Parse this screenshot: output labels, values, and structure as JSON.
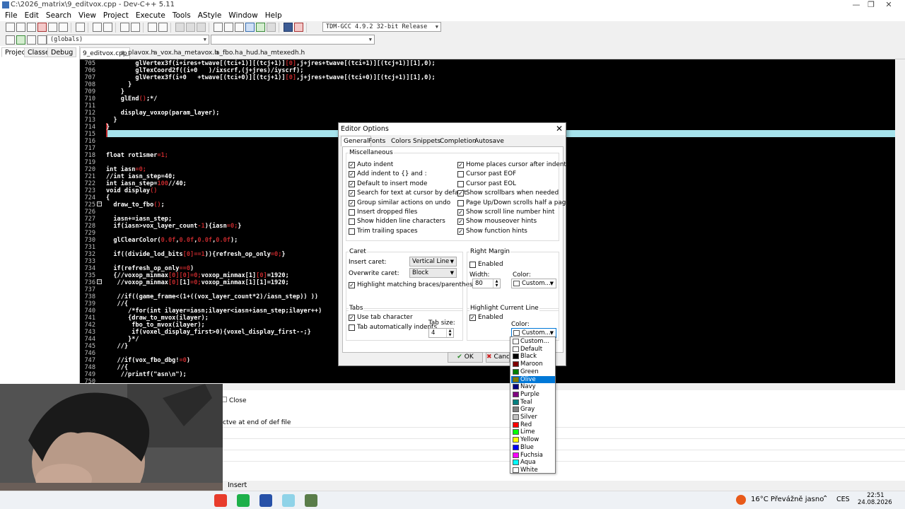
{
  "window": {
    "title": "C:\\2026_matrix\\9_editvox.cpp - Dev-C++ 5.11",
    "minimize": "—",
    "maximize": "❐",
    "close": "✕"
  },
  "menu": [
    "File",
    "Edit",
    "Search",
    "View",
    "Project",
    "Execute",
    "Tools",
    "AStyle",
    "Window",
    "Help"
  ],
  "toolbar": {
    "compiler": "TDM-GCC 4.9.2 32-bit Release",
    "scope": "(globals)"
  },
  "left_tabs": [
    "Project",
    "Classes",
    "Debug"
  ],
  "file_tabs": [
    "9_editvox.cpp",
    "a_plavox.h",
    "a_vox.h",
    "a_metavox.h",
    "a_fbo.h",
    "a_hud.h",
    "a_mtexedh.h"
  ],
  "code_lines": [
    {
      "n": "705",
      "t": "        glVertex3f(i+ires+twave[(tci+1)][(tcj+1)][0],j+jres+twave[(tci+1)][(tcj+1)][1],0);"
    },
    {
      "n": "706",
      "t": "        glTexCoord2f((i+0   )/ixscrf,(j+jres)/iyscrf);"
    },
    {
      "n": "707",
      "t": "        glVertex3f(i+0   +twave[(tci+0)][(tcj+1)][0],j+jres+twave[(tci+0)][(tcj+1)][1],0);"
    },
    {
      "n": "708",
      "t": "      }"
    },
    {
      "n": "709",
      "t": "    }"
    },
    {
      "n": "710",
      "t": "    glEnd();*/"
    },
    {
      "n": "711",
      "t": ""
    },
    {
      "n": "712",
      "t": "    display_voxop(param_layer);"
    },
    {
      "n": "713",
      "t": "  }"
    },
    {
      "n": "714",
      "t": "}"
    },
    {
      "n": "715",
      "t": ""
    },
    {
      "n": "716",
      "t": ""
    },
    {
      "n": "717",
      "t": ""
    },
    {
      "n": "718",
      "t": "float rot1smer=1;"
    },
    {
      "n": "719",
      "t": ""
    },
    {
      "n": "720",
      "t": "int iasn=0;"
    },
    {
      "n": "721",
      "t": "//int iasn_step=40;"
    },
    {
      "n": "722",
      "t": "int iasn_step=100//40;"
    },
    {
      "n": "723",
      "t": "void display()"
    },
    {
      "n": "724",
      "t": "{"
    },
    {
      "n": "725",
      "t": "  draw_to_fbo();"
    },
    {
      "n": "726",
      "t": ""
    },
    {
      "n": "727",
      "t": "  iasn+=iasn_step;"
    },
    {
      "n": "728",
      "t": "  if(iasn>vox_layer_count-1){iasn=0;}"
    },
    {
      "n": "729",
      "t": ""
    },
    {
      "n": "730",
      "t": "  glClearColor(0.0f,0.0f,0.0f,0.0f);"
    },
    {
      "n": "731",
      "t": ""
    },
    {
      "n": "732",
      "t": "  if((divide_lod_bits[0]==1)){refresh_op_only=0;}"
    },
    {
      "n": "733",
      "t": ""
    },
    {
      "n": "734",
      "t": "  if(refresh_op_only==0)"
    },
    {
      "n": "735",
      "t": "  {//voxop_minmax[0][0]=0;voxop_minmax[1][0]=1920;"
    },
    {
      "n": "736",
      "t": "   //voxop_minmax[0][1]=0;voxop_minmax[1][1]=1920;"
    },
    {
      "n": "737",
      "t": ""
    },
    {
      "n": "738",
      "t": "   //if((game_frame<(1+((vox_layer_count*2)/iasn_step)) ))"
    },
    {
      "n": "739",
      "t": "   //{"
    },
    {
      "n": "740",
      "t": "      /*for(int ilayer=iasn;ilayer<iasn+iasn_step;ilayer++)"
    },
    {
      "n": "741",
      "t": "      {draw_to_mvox(ilayer);"
    },
    {
      "n": "742",
      "t": "       fbo_to_mvox(ilayer);"
    },
    {
      "n": "743",
      "t": "       if(voxel_display_first>0){voxel_display_first--;}"
    },
    {
      "n": "744",
      "t": "      }*/"
    },
    {
      "n": "745",
      "t": "   //}"
    },
    {
      "n": "746",
      "t": ""
    },
    {
      "n": "747",
      "t": "   //if(vox_fbo_dbg!=0)"
    },
    {
      "n": "748",
      "t": "   //{"
    },
    {
      "n": "749",
      "t": "    //printf(\"asn\\n\");"
    },
    {
      "n": "750",
      "t": ""
    }
  ],
  "bottom": {
    "close_label": "Close",
    "message": "ctve at end of def file",
    "status": "Insert"
  },
  "dialog": {
    "title": "Editor Options",
    "close": "✕",
    "tabs": [
      "General",
      "Fonts",
      "Colors",
      "Snippets",
      "Completion",
      "Autosave"
    ],
    "misc_title": "Miscellaneous",
    "left_checks": [
      {
        "label": "Auto indent",
        "checked": true
      },
      {
        "label": "Add indent to {} and :",
        "checked": true
      },
      {
        "label": "Default to insert mode",
        "checked": true
      },
      {
        "label": "Search for text at cursor by default",
        "checked": true
      },
      {
        "label": "Group similar actions on undo",
        "checked": true
      },
      {
        "label": "Insert dropped files",
        "checked": false
      },
      {
        "label": "Show hidden line characters",
        "checked": false
      },
      {
        "label": "Trim trailing spaces",
        "checked": false
      }
    ],
    "right_checks": [
      {
        "label": "Home places cursor after indent",
        "checked": true
      },
      {
        "label": "Cursor past EOF",
        "checked": false
      },
      {
        "label": "Cursor past EOL",
        "checked": false
      },
      {
        "label": "Show scrollbars when needed",
        "checked": true
      },
      {
        "label": "Page Up/Down scrolls half a page",
        "checked": false
      },
      {
        "label": "Show scroll line number hint",
        "checked": true
      },
      {
        "label": "Show mouseover hints",
        "checked": true
      },
      {
        "label": "Show function hints",
        "checked": true
      }
    ],
    "caret": {
      "title": "Caret",
      "insert_label": "Insert caret:",
      "insert_value": "Vertical Line",
      "overwrite_label": "Overwrite caret:",
      "overwrite_value": "Block",
      "highlight": "Highlight matching braces/parentheses"
    },
    "margin": {
      "title": "Right Margin",
      "enabled": "Enabled",
      "width_label": "Width:",
      "width_value": "80",
      "color_label": "Color:",
      "color_value": "Custom..."
    },
    "tabs_group": {
      "title": "Tabs",
      "use_tab": "Use tab character",
      "auto": "Tab automatically indents",
      "size_label": "Tab size:",
      "size_value": "4"
    },
    "hcl": {
      "title": "Highlight Current Line",
      "enabled": "Enabled",
      "color_label": "Color:",
      "color_value": "Custom..."
    },
    "ok": "OK",
    "cancel": "Cancel"
  },
  "color_options": [
    {
      "name": "Custom...",
      "hex": "#ffffff"
    },
    {
      "name": "Default",
      "hex": "#ffffff"
    },
    {
      "name": "Black",
      "hex": "#000000"
    },
    {
      "name": "Maroon",
      "hex": "#800000"
    },
    {
      "name": "Green",
      "hex": "#008000"
    },
    {
      "name": "Olive",
      "hex": "#808000"
    },
    {
      "name": "Navy",
      "hex": "#000080"
    },
    {
      "name": "Purple",
      "hex": "#800080"
    },
    {
      "name": "Teal",
      "hex": "#008080"
    },
    {
      "name": "Gray",
      "hex": "#808080"
    },
    {
      "name": "Silver",
      "hex": "#c0c0c0"
    },
    {
      "name": "Red",
      "hex": "#ff0000"
    },
    {
      "name": "Lime",
      "hex": "#00ff00"
    },
    {
      "name": "Yellow",
      "hex": "#ffff00"
    },
    {
      "name": "Blue",
      "hex": "#0000ff"
    },
    {
      "name": "Fuchsia",
      "hex": "#ff00ff"
    },
    {
      "name": "Aqua",
      "hex": "#00ffff"
    },
    {
      "name": "White",
      "hex": "#ffffff"
    }
  ],
  "selected_color": "Olive",
  "tray": {
    "weather": "16°C  Převážně jasno",
    "lang": "CES",
    "time": "22:51",
    "date": "24.08.2026"
  }
}
